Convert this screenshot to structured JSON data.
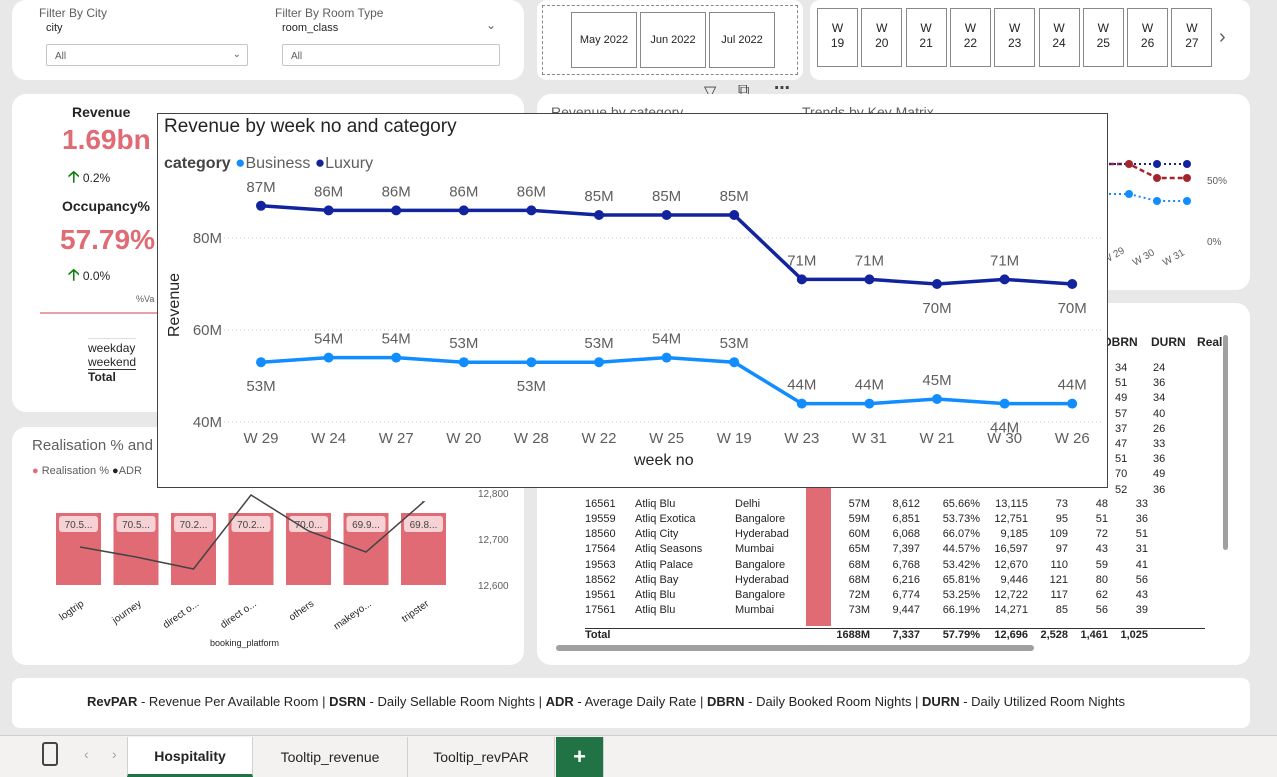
{
  "filters": {
    "city": {
      "title": "Filter By City",
      "field": "city",
      "value": "All"
    },
    "room": {
      "title": "Filter By Room Type",
      "field": "room_class",
      "value": "All"
    }
  },
  "months": [
    "May 2022",
    "Jun 2022",
    "Jul 2022"
  ],
  "weeks": [
    {
      "w": "W",
      "n": "19"
    },
    {
      "w": "W",
      "n": "20"
    },
    {
      "w": "W",
      "n": "21"
    },
    {
      "w": "W",
      "n": "22"
    },
    {
      "w": "W",
      "n": "23"
    },
    {
      "w": "W",
      "n": "24"
    },
    {
      "w": "W",
      "n": "25"
    },
    {
      "w": "W",
      "n": "26"
    },
    {
      "w": "W",
      "n": "27"
    }
  ],
  "kpi": {
    "revenue_title": "Revenue",
    "revenue_value": "1.69bn",
    "revenue_delta": "0.2%",
    "occupancy_title": "Occupancy%",
    "occupancy_value": "57.79%",
    "occupancy_delta": "0.0%",
    "va_label": "%Va",
    "day_types": [
      "weekday",
      "weekend"
    ],
    "total_label": "Total"
  },
  "realisation": {
    "title": "Realisation % and",
    "legend": [
      "Realisation %",
      "ADR"
    ],
    "bars": [
      {
        "label": "70.5...",
        "cat": "logtrip"
      },
      {
        "label": "70.5...",
        "cat": "journey"
      },
      {
        "label": "70.2...",
        "cat": "direct o..."
      },
      {
        "label": "70.2...",
        "cat": "direct o..."
      },
      {
        "label": "70.0...",
        "cat": "others"
      },
      {
        "label": "69.9...",
        "cat": "makeyo..."
      },
      {
        "label": "69.8...",
        "cat": "tripster"
      }
    ],
    "adr_ticks": [
      "12,800",
      "12,700",
      "12,600"
    ],
    "xlabel": "booking_platform"
  },
  "trends": {
    "header_left": "Revenue by category",
    "header_right": "Trends by Key Matrix",
    "pct_ticks": [
      "50%",
      "0%"
    ],
    "x_ticks": [
      "W 29",
      "W 30",
      "W 31"
    ]
  },
  "matrix": {
    "headers": [
      "DBRN",
      "DURN",
      "Real"
    ],
    "top_rows": [
      [
        "34",
        "24"
      ],
      [
        "51",
        "36"
      ],
      [
        "49",
        "34"
      ],
      [
        "57",
        "40"
      ],
      [
        "37",
        "26"
      ],
      [
        "47",
        "33"
      ],
      [
        "51",
        "36"
      ],
      [
        "70",
        "49"
      ],
      [
        "52",
        "36"
      ]
    ],
    "rows": [
      [
        "19559",
        "Atliq Exotica",
        "Bangalore",
        "59M",
        "6,851",
        "53.73%",
        "12,751",
        "95",
        "51",
        "36"
      ],
      [
        "18560",
        "Atliq City",
        "Hyderabad",
        "60M",
        "6,068",
        "66.07%",
        "9,185",
        "109",
        "72",
        "51"
      ],
      [
        "17564",
        "Atliq Seasons",
        "Mumbai",
        "65M",
        "7,397",
        "44.57%",
        "16,597",
        "97",
        "43",
        "31"
      ],
      [
        "19563",
        "Atliq Palace",
        "Bangalore",
        "68M",
        "6,768",
        "53.42%",
        "12,670",
        "110",
        "59",
        "41"
      ],
      [
        "18562",
        "Atliq Bay",
        "Hyderabad",
        "68M",
        "6,216",
        "65.81%",
        "9,446",
        "121",
        "80",
        "56"
      ],
      [
        "19561",
        "Atliq Blu",
        "Bangalore",
        "72M",
        "6,774",
        "53.25%",
        "12,722",
        "117",
        "62",
        "43"
      ],
      [
        "17561",
        "Atliq Blu",
        "Mumbai",
        "73M",
        "9,447",
        "66.19%",
        "14,271",
        "85",
        "56",
        "39"
      ]
    ],
    "partial_top": [
      "16561",
      "Atliq Blu",
      "Delhi",
      "57M",
      "8,612",
      "65.66%",
      "13,115",
      "73",
      "48",
      "33"
    ],
    "total": [
      "Total",
      "1688M",
      "7,337",
      "57.79%",
      "12,696",
      "2,528",
      "1,461",
      "1,025"
    ]
  },
  "footer": [
    {
      "b": "RevPAR",
      "t": " - Revenue Per Available Room | "
    },
    {
      "b": "DSRN",
      "t": " - Daily Sellable Room Nights | "
    },
    {
      "b": "ADR",
      "t": " - Average Daily Rate | "
    },
    {
      "b": "DBRN",
      "t": " - Daily Booked Room Nights | "
    },
    {
      "b": "DURN",
      "t": " - Daily Utilized Room Nights"
    }
  ],
  "tabs": [
    "Hospitality",
    "Tooltip_revenue",
    "Tooltip_revPAR"
  ],
  "add_tab": "+",
  "chart_data": {
    "type": "line",
    "title": "Revenue by week no and category",
    "legend_title": "category",
    "xlabel": "week no",
    "ylabel": "Revenue",
    "y_ticks": [
      "80M",
      "60M",
      "40M"
    ],
    "ylim": [
      40,
      80
    ],
    "categories": [
      "W 29",
      "W 24",
      "W 27",
      "W 20",
      "W 28",
      "W 22",
      "W 25",
      "W 19",
      "W 23",
      "W 31",
      "W 21",
      "W 30",
      "W 26"
    ],
    "series": [
      {
        "name": "Business",
        "color": "#118dff",
        "values": [
          53,
          54,
          54,
          53,
          53,
          53,
          54,
          53,
          44,
          44,
          45,
          44,
          44
        ],
        "labels": [
          "53M",
          "54M",
          "54M",
          "53M",
          "53M",
          "53M",
          "54M",
          "53M",
          "44M",
          "44M",
          "45M",
          "44M",
          "44M"
        ]
      },
      {
        "name": "Luxury",
        "color": "#12239e",
        "values": [
          87,
          86,
          86,
          86,
          86,
          85,
          85,
          85,
          71,
          71,
          70,
          71,
          70
        ],
        "labels": [
          "87M",
          "86M",
          "86M",
          "86M",
          "86M",
          "85M",
          "85M",
          "85M",
          "71M",
          "71M",
          "70M",
          "71M",
          "70M"
        ]
      }
    ]
  }
}
